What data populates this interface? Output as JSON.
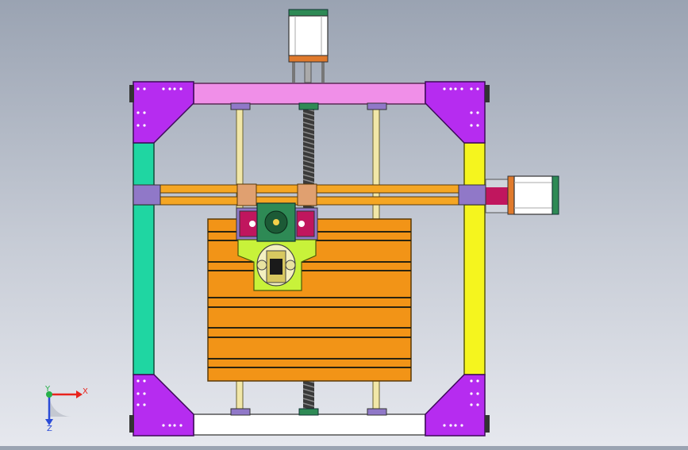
{
  "viewport": {
    "background_top": "#9aa3b2",
    "background_bottom": "#e6e8ee"
  },
  "model": {
    "colors": {
      "corner_plate": "#b62cf0",
      "top_rail": "#f08fe8",
      "bottom_rail": "#ffffff",
      "left_rail": "#1fd6a2",
      "right_rail": "#f5f51e",
      "gantry_rail": "#f5a623",
      "build_plate": "#f29417",
      "plate_slots": "#2a2410",
      "carriage": "#c8f23a",
      "motor_body": "#ffffff",
      "motor_flange": "#e07a2c",
      "motor_cap": "#2e8a55",
      "bearing_block": "#9078c8",
      "lead_screw": "#2a2a2a",
      "guide_rod": "#f1e7a8",
      "magenta_block": "#c0165e"
    }
  },
  "triad": {
    "x_label": "X",
    "y_label": "Y",
    "z_label": "Z",
    "x_color": "#e8231c",
    "y_color": "#27b04a",
    "z_color": "#2a4bd7"
  }
}
